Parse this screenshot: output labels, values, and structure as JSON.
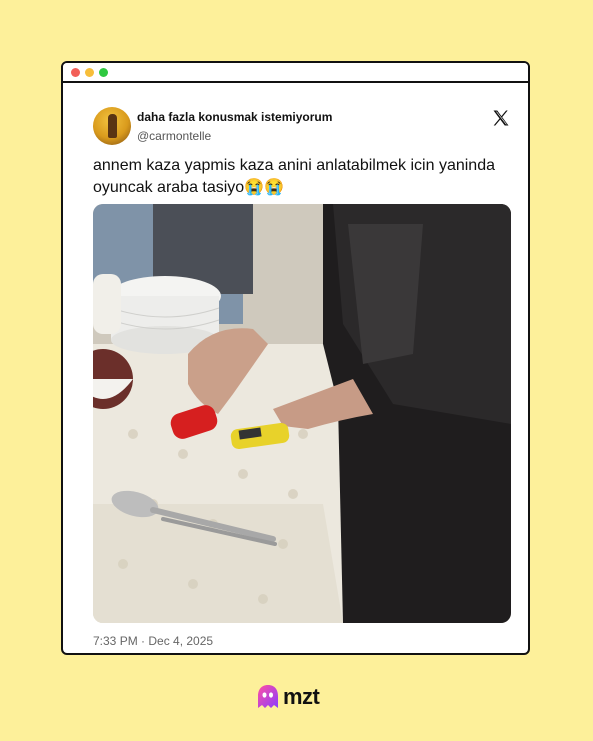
{
  "window": {
    "controls": [
      "close",
      "minimize",
      "maximize"
    ],
    "control_colors": {
      "close": "#f25f58",
      "minimize": "#f7be3a",
      "maximize": "#2fc840"
    }
  },
  "tweet": {
    "display_name": "daha fazla konusmak istemiyorum",
    "handle": "@carmontelle",
    "text": "annem kaza yapmis kaza anini anlatabilmek icin yaninda oyuncak araba tasiyo😭😭",
    "timestamp": "7:33 PM · Dec 4, 2025",
    "platform_icon": "x-logo-icon",
    "photo_description_icon": "photo"
  },
  "brand": {
    "name": "mzt",
    "logo_icon": "ghost-icon",
    "logo_colors": [
      "#ff4fa3",
      "#8b3cff"
    ]
  },
  "colors": {
    "background": "#fdf09a",
    "window_border": "#111111"
  }
}
